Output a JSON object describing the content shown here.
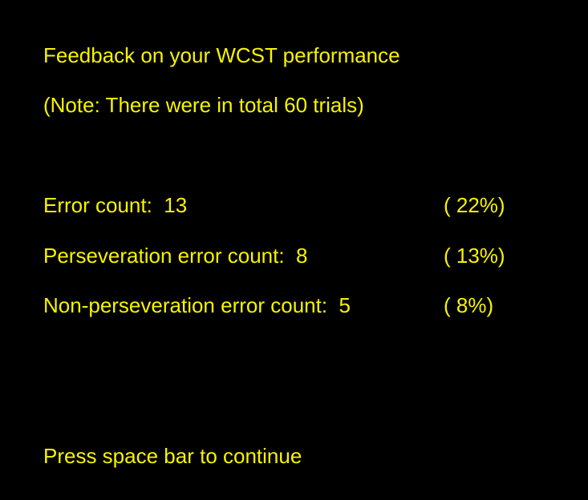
{
  "feedback": {
    "title": "Feedback on your WCST performance",
    "note": "(Note: There were in total 60 trials)",
    "stats": [
      {
        "label": "Error count:  13",
        "percent": "( 22%)"
      },
      {
        "label": "Perseveration error count:  8",
        "percent": "( 13%)"
      },
      {
        "label": "Non-perseveration error count:  5",
        "percent": "( 8%)"
      }
    ],
    "prompt": "Press space bar to continue"
  },
  "colors": {
    "background": "#000000",
    "text": "#f7f300"
  }
}
